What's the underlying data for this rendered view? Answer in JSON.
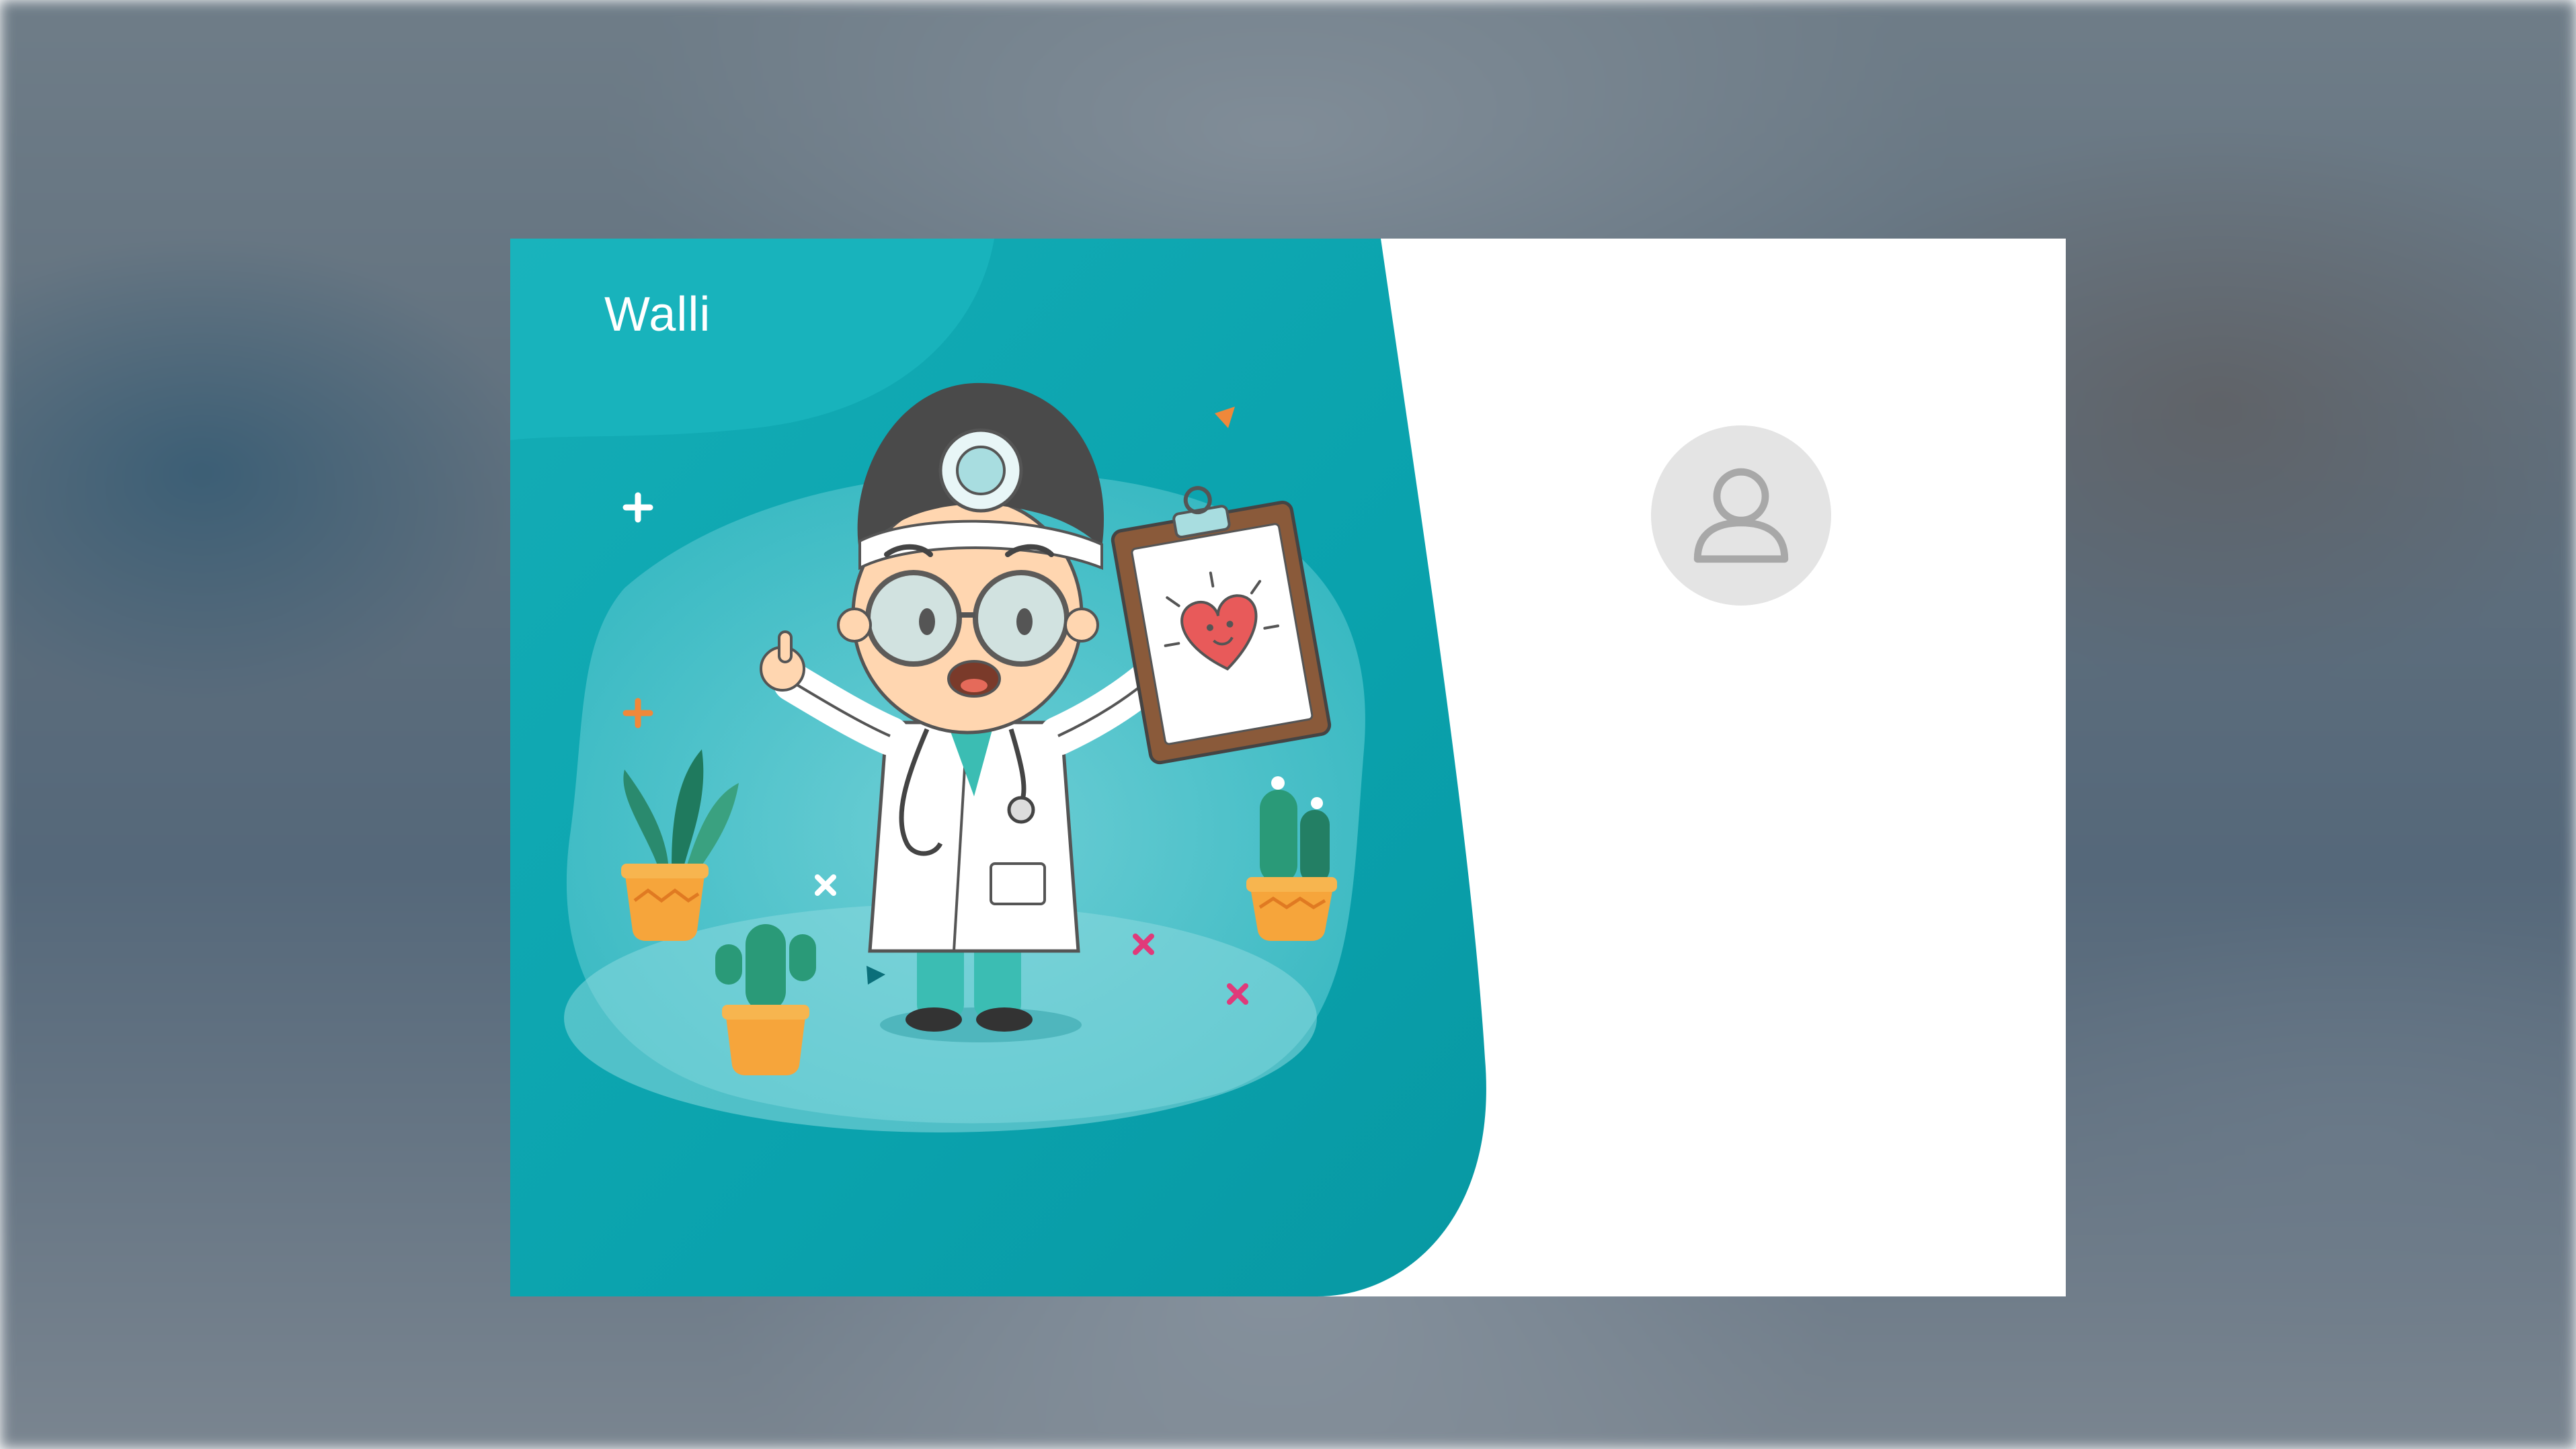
{
  "brand": {
    "name": "Walli"
  },
  "account": {
    "avatar_icon": "user-icon"
  },
  "colors": {
    "panel_teal": "#0aa3ad",
    "panel_teal_light": "#5ec9d0",
    "card_background": "#ffffff",
    "avatar_background": "#e4e4e4",
    "avatar_icon": "#a8a8a8"
  },
  "illustration": {
    "subject": "doctor-with-clipboard-icon"
  }
}
